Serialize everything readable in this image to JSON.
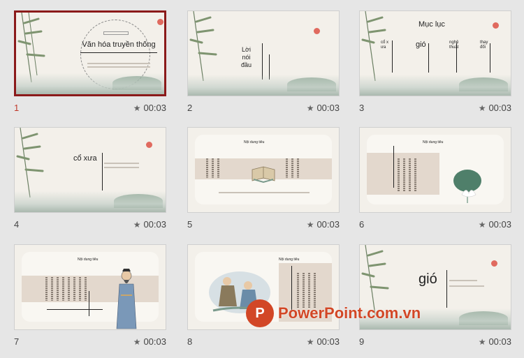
{
  "slides": [
    {
      "number": "1",
      "time": "00:03",
      "title": "Văn hóa truyền thống"
    },
    {
      "number": "2",
      "time": "00:03",
      "title_lines": [
        "Lời",
        "nói",
        "đầu"
      ]
    },
    {
      "number": "3",
      "time": "00:03",
      "title": "Mục lục",
      "items": [
        "cổ xưa",
        "gió",
        "nghệ thuật",
        "thay đổi"
      ]
    },
    {
      "number": "4",
      "time": "00:03",
      "title": "cổ xưa"
    },
    {
      "number": "5",
      "time": "00:03",
      "heading": "Nội dung tiêu"
    },
    {
      "number": "6",
      "time": "00:03",
      "heading": "Nội dung tiêu"
    },
    {
      "number": "7",
      "time": "00:03",
      "heading": "Nội dung tiêu"
    },
    {
      "number": "8",
      "time": "00:03",
      "heading": "Nội dung tiêu"
    },
    {
      "number": "9",
      "time": "00:03",
      "title": "gió"
    }
  ],
  "watermark": {
    "text": "PowerPoint.com.vn",
    "badge_letter": "P"
  },
  "colors": {
    "selection": "#8b1a1a",
    "accent_red": "#e06a5f",
    "brand": "#d24726"
  }
}
